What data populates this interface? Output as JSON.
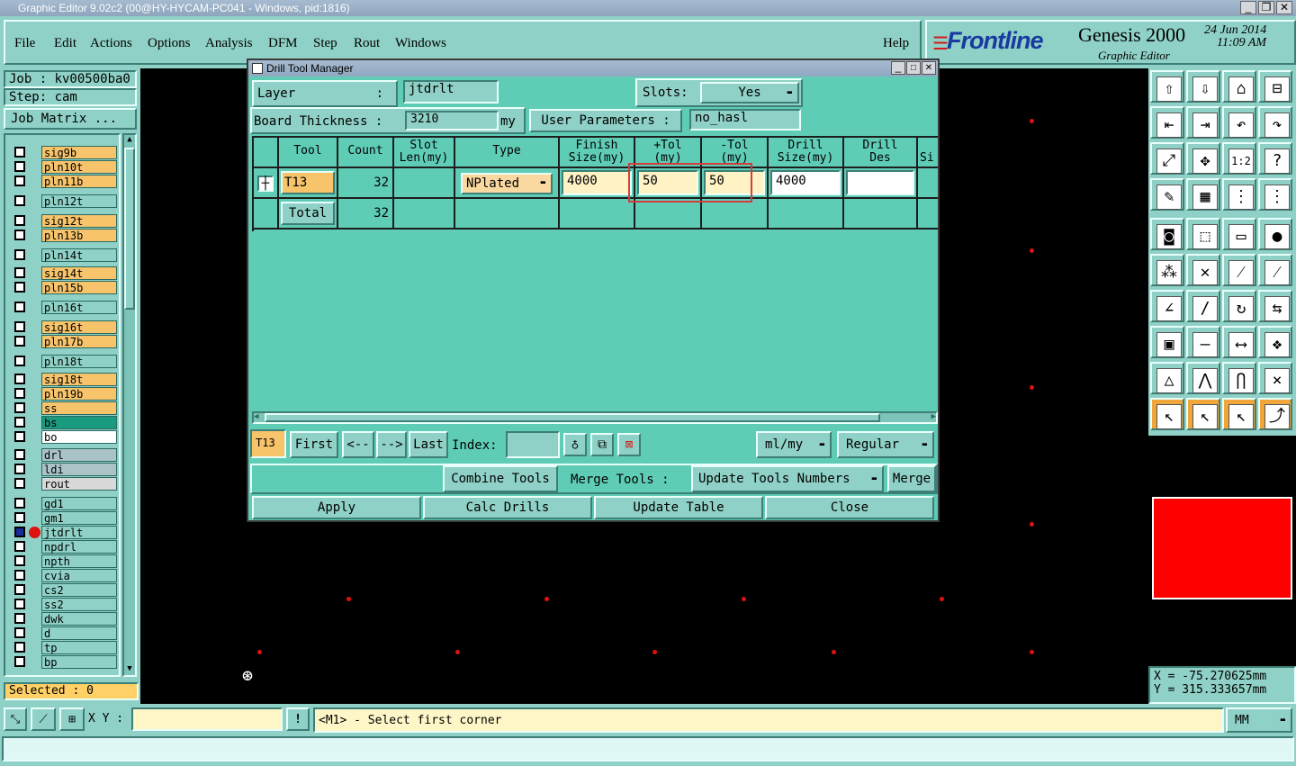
{
  "window_title": "Graphic Editor 9.02c2 (00@HY-HYCAM-PC041 - Windows, pid:1816)",
  "menu": [
    "File",
    "Edit",
    "Actions",
    "Options",
    "Analysis",
    "DFM",
    "Step",
    "Rout",
    "Windows"
  ],
  "help": "Help",
  "brand": {
    "logo": "Frontline",
    "product": "Genesis 2000",
    "subtitle": "Graphic Editor",
    "date": "24 Jun 2014",
    "time": "11:09 AM"
  },
  "left_panel": {
    "job": "Job : kv00500ba0",
    "step": "Step: cam",
    "job_matrix": "Job Matrix ...",
    "selected": "Selected : 0",
    "layers": [
      {
        "name": "sig9b",
        "color": "#f7c36b"
      },
      {
        "name": "pln10t",
        "color": "#f7c36b"
      },
      {
        "name": "pln11b",
        "color": "#f7c36b"
      },
      {
        "name": "pln12t",
        "color": "#8fd1c6"
      },
      {
        "name": "sig12t",
        "color": "#f7c36b"
      },
      {
        "name": "pln13b",
        "color": "#f7c36b"
      },
      {
        "name": "pln14t",
        "color": "#8fd1c6"
      },
      {
        "name": "sig14t",
        "color": "#f7c36b"
      },
      {
        "name": "pln15b",
        "color": "#f7c36b"
      },
      {
        "name": "pln16t",
        "color": "#8fd1c6"
      },
      {
        "name": "sig16t",
        "color": "#f7c36b"
      },
      {
        "name": "pln17b",
        "color": "#f7c36b"
      },
      {
        "name": "pln18t",
        "color": "#8fd1c6"
      },
      {
        "name": "sig18t",
        "color": "#f7c36b"
      },
      {
        "name": "pln19b",
        "color": "#f7c36b"
      },
      {
        "name": "ss",
        "color": "#f7c36b"
      },
      {
        "name": "bs",
        "color": "#1a9a7e"
      },
      {
        "name": "bo",
        "color": "#ffffff"
      },
      {
        "name": "drl",
        "color": "#a9c3c7"
      },
      {
        "name": "ldi",
        "color": "#a9c3c7"
      },
      {
        "name": "rout",
        "color": "#d8d8d8"
      },
      {
        "name": "gd1",
        "color": "#8fd1c6"
      },
      {
        "name": "gm1",
        "color": "#8fd1c6"
      },
      {
        "name": "jtdrlt",
        "color": "#8fd1c6"
      },
      {
        "name": "npdrl",
        "color": "#8fd1c6"
      },
      {
        "name": "npth",
        "color": "#8fd1c6"
      },
      {
        "name": "cvia",
        "color": "#8fd1c6"
      },
      {
        "name": "cs2",
        "color": "#8fd1c6"
      },
      {
        "name": "ss2",
        "color": "#8fd1c6"
      },
      {
        "name": "dwk",
        "color": "#8fd1c6"
      },
      {
        "name": "d",
        "color": "#8fd1c6"
      },
      {
        "name": "tp",
        "color": "#8fd1c6"
      },
      {
        "name": "bp",
        "color": "#8fd1c6"
      }
    ]
  },
  "dialog": {
    "title": "Drill Tool Manager",
    "layer_label": "Layer",
    "layer_colon": ":",
    "layer_value": "jtdrlt",
    "slots_label": "Slots:",
    "slots_value": "Yes",
    "board_thickness_label": "Board Thickness :",
    "board_thickness_value": "3210",
    "board_thickness_unit": "my",
    "user_params_label": "User Parameters :",
    "user_params_value": "no_hasl",
    "columns": [
      "Tool",
      "Count",
      "Slot Len(my)",
      "Type",
      "Finish Size(my)",
      "+Tol (my)",
      "-Tol (my)",
      "Drill Size(my)",
      "Drill Des",
      "Si"
    ],
    "row": {
      "tool": "T13",
      "count": "32",
      "type": "NPlated",
      "finish": "4000",
      "ptol": "50",
      "ntol": "50",
      "drill": "4000",
      "des": ""
    },
    "total": {
      "label": "Total",
      "count": "32"
    },
    "nav": {
      "current": "T13",
      "first": "First",
      "prev": "<--",
      "next": "-->",
      "last": "Last",
      "index_label": "Index:",
      "units": "ml/my",
      "mode": "Regular"
    },
    "actions": {
      "combine": "Combine Tools",
      "merge_label": "Merge Tools :",
      "update_numbers": "Update Tools Numbers",
      "merge": "Merge"
    },
    "footer": {
      "apply": "Apply",
      "calc": "Calc Drills",
      "update": "Update Table",
      "close": "Close"
    }
  },
  "status": {
    "xy_label": "X Y :",
    "xy_value": "",
    "prompt": "<M1> - Select first corner",
    "units": "MM",
    "x": "X = -75.270625mm",
    "y": "Y = 315.333657mm"
  }
}
